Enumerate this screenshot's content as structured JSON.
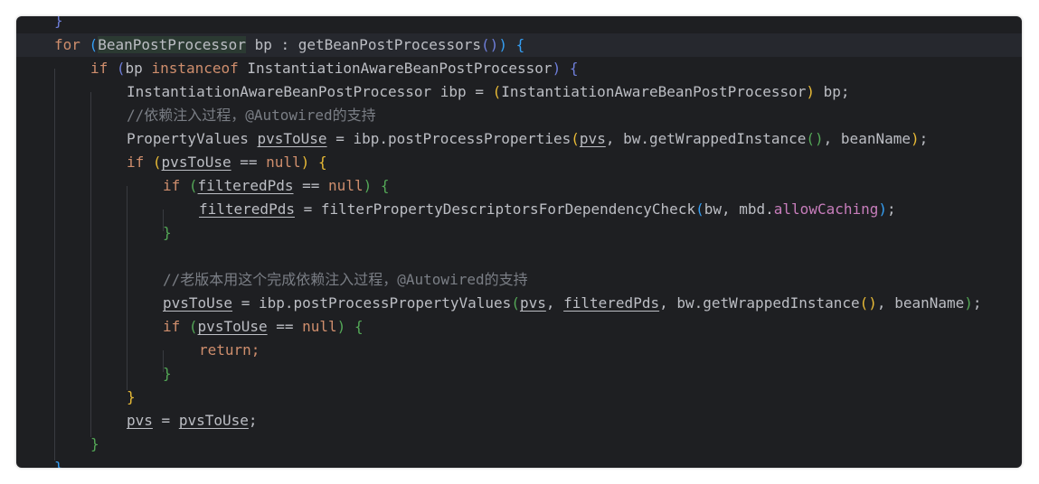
{
  "editor": {
    "lines": [
      {
        "id": "l0",
        "parts": [
          {
            "t": "}",
            "c": "p4"
          }
        ]
      },
      {
        "id": "l1",
        "parts": [
          {
            "t": "for",
            "c": "kw"
          },
          {
            "t": " "
          },
          {
            "t": "(",
            "c": "p3"
          },
          {
            "t": "BeanPostProcessor",
            "c": "hl"
          },
          {
            "t": " bp : getBeanPostProcessors"
          },
          {
            "t": "()",
            "c": "p4"
          },
          {
            "t": ")",
            "c": "p3"
          },
          {
            "t": " "
          },
          {
            "t": "{",
            "c": "p3"
          }
        ]
      },
      {
        "id": "l2",
        "parts": [
          {
            "t": "if",
            "c": "kw"
          },
          {
            "t": " "
          },
          {
            "t": "(",
            "c": "p4"
          },
          {
            "t": "bp "
          },
          {
            "t": "instanceof",
            "c": "kw"
          },
          {
            "t": " InstantiationAwareBeanPostProcessor"
          },
          {
            "t": ")",
            "c": "p4"
          },
          {
            "t": " "
          },
          {
            "t": "{",
            "c": "p4"
          }
        ]
      },
      {
        "id": "l3",
        "parts": [
          {
            "t": "InstantiationAwareBeanPostProcessor ibp = "
          },
          {
            "t": "(",
            "c": "p1"
          },
          {
            "t": "InstantiationAwareBeanPostProcessor"
          },
          {
            "t": ")",
            "c": "p1"
          },
          {
            "t": " bp;"
          }
        ]
      },
      {
        "id": "l4",
        "parts": [
          {
            "t": "//依赖注入过程，@Autowired的支持",
            "c": "cm"
          }
        ]
      },
      {
        "id": "l5",
        "parts": [
          {
            "t": "PropertyValues "
          },
          {
            "t": "pvsToUse",
            "c": "var"
          },
          {
            "t": " = ibp.postProcessProperties"
          },
          {
            "t": "(",
            "c": "p1"
          },
          {
            "t": "pvs",
            "c": "var"
          },
          {
            "t": ", bw.getWrappedInstance"
          },
          {
            "t": "()",
            "c": "p2"
          },
          {
            "t": ", beanName"
          },
          {
            "t": ")",
            "c": "p1"
          },
          {
            "t": ";"
          }
        ]
      },
      {
        "id": "l6",
        "parts": [
          {
            "t": "if",
            "c": "kw"
          },
          {
            "t": " "
          },
          {
            "t": "(",
            "c": "p1"
          },
          {
            "t": "pvsToUse",
            "c": "var"
          },
          {
            "t": " == "
          },
          {
            "t": "null",
            "c": "kw"
          },
          {
            "t": ")",
            "c": "p1"
          },
          {
            "t": " "
          },
          {
            "t": "{",
            "c": "p1"
          }
        ]
      },
      {
        "id": "l7",
        "parts": [
          {
            "t": "if",
            "c": "kw"
          },
          {
            "t": " "
          },
          {
            "t": "(",
            "c": "p2"
          },
          {
            "t": "filteredPds",
            "c": "var"
          },
          {
            "t": " == "
          },
          {
            "t": "null",
            "c": "kw"
          },
          {
            "t": ")",
            "c": "p2"
          },
          {
            "t": " "
          },
          {
            "t": "{",
            "c": "p2"
          }
        ]
      },
      {
        "id": "l8",
        "parts": [
          {
            "t": "filteredPds",
            "c": "var"
          },
          {
            "t": " = filterPropertyDescriptorsForDependencyCheck"
          },
          {
            "t": "(",
            "c": "p3"
          },
          {
            "t": "bw, mbd."
          },
          {
            "t": "allowCaching",
            "c": "field"
          },
          {
            "t": ")",
            "c": "p3"
          },
          {
            "t": ";"
          }
        ]
      },
      {
        "id": "l9",
        "parts": [
          {
            "t": "}",
            "c": "p2"
          }
        ]
      },
      {
        "id": "l10",
        "parts": []
      },
      {
        "id": "l11",
        "parts": [
          {
            "t": "//老版本用这个完成依赖注入过程，@Autowired的支持",
            "c": "cm"
          }
        ]
      },
      {
        "id": "l12",
        "parts": [
          {
            "t": "pvsToUse",
            "c": "var"
          },
          {
            "t": " = ibp.postProcessPropertyValues"
          },
          {
            "t": "(",
            "c": "p2"
          },
          {
            "t": "pvs",
            "c": "var"
          },
          {
            "t": ", "
          },
          {
            "t": "filteredPds",
            "c": "var"
          },
          {
            "t": ", bw.getWrappedInstance"
          },
          {
            "t": "()",
            "c": "p1"
          },
          {
            "t": ", beanName"
          },
          {
            "t": ")",
            "c": "p2"
          },
          {
            "t": ";"
          }
        ]
      },
      {
        "id": "l13",
        "parts": [
          {
            "t": "if",
            "c": "kw"
          },
          {
            "t": " "
          },
          {
            "t": "(",
            "c": "p2"
          },
          {
            "t": "pvsToUse",
            "c": "var"
          },
          {
            "t": " == "
          },
          {
            "t": "null",
            "c": "kw"
          },
          {
            "t": ")",
            "c": "p2"
          },
          {
            "t": " "
          },
          {
            "t": "{",
            "c": "p2"
          }
        ]
      },
      {
        "id": "l14",
        "parts": [
          {
            "t": "return",
            "c": "kw"
          },
          {
            "t": ";",
            "c": "kw"
          }
        ]
      },
      {
        "id": "l15",
        "parts": [
          {
            "t": "}",
            "c": "p2"
          }
        ]
      },
      {
        "id": "l16",
        "parts": [
          {
            "t": "}",
            "c": "p1"
          }
        ]
      },
      {
        "id": "l17",
        "parts": [
          {
            "t": "pvs",
            "c": "var"
          },
          {
            "t": " = "
          },
          {
            "t": "pvsToUse",
            "c": "var"
          },
          {
            "t": ";"
          }
        ]
      },
      {
        "id": "l18",
        "parts": [
          {
            "t": "}",
            "c": "p2"
          }
        ]
      },
      {
        "id": "l19",
        "parts": [
          {
            "t": "}",
            "c": "p3"
          }
        ]
      }
    ]
  }
}
